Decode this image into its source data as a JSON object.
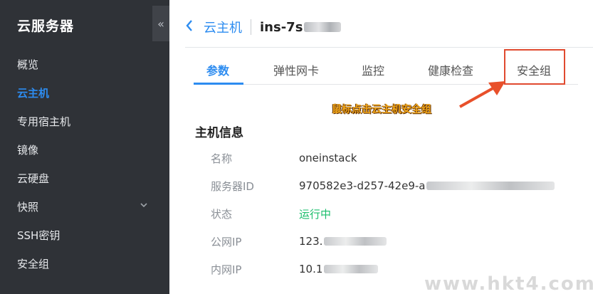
{
  "sidebar": {
    "title": "云服务器",
    "collapse_glyph": "«",
    "items": [
      {
        "label": "概览"
      },
      {
        "label": "云主机"
      },
      {
        "label": "专用宿主机"
      },
      {
        "label": "镜像"
      },
      {
        "label": "云硬盘"
      },
      {
        "label": "快照"
      },
      {
        "label": "SSH密钥"
      },
      {
        "label": "安全组"
      }
    ],
    "active_index": 1
  },
  "breadcrumb": {
    "parent": "云主机",
    "current": "ins-7s"
  },
  "tabs": [
    {
      "label": "参数"
    },
    {
      "label": "弹性网卡"
    },
    {
      "label": "监控"
    },
    {
      "label": "健康检查"
    },
    {
      "label": "安全组"
    }
  ],
  "annotation": "鼠标点击云主机安全组",
  "host_info": {
    "title": "主机信息",
    "rows": [
      {
        "label": "名称",
        "value": "oneinstack"
      },
      {
        "label": "服务器ID",
        "value": "970582e3-d257-42e9-a"
      },
      {
        "label": "状态",
        "value": "运行中"
      },
      {
        "label": "公网IP",
        "value": "123."
      },
      {
        "label": "内网IP",
        "value": "10.1"
      }
    ]
  },
  "watermark": "www.hkt4.com",
  "colors": {
    "sidebar_bg": "#2f3237",
    "accent": "#2d8cf0",
    "running": "#19be6b",
    "highlight": "#e04a2f",
    "annotation": "#f2a71a"
  }
}
